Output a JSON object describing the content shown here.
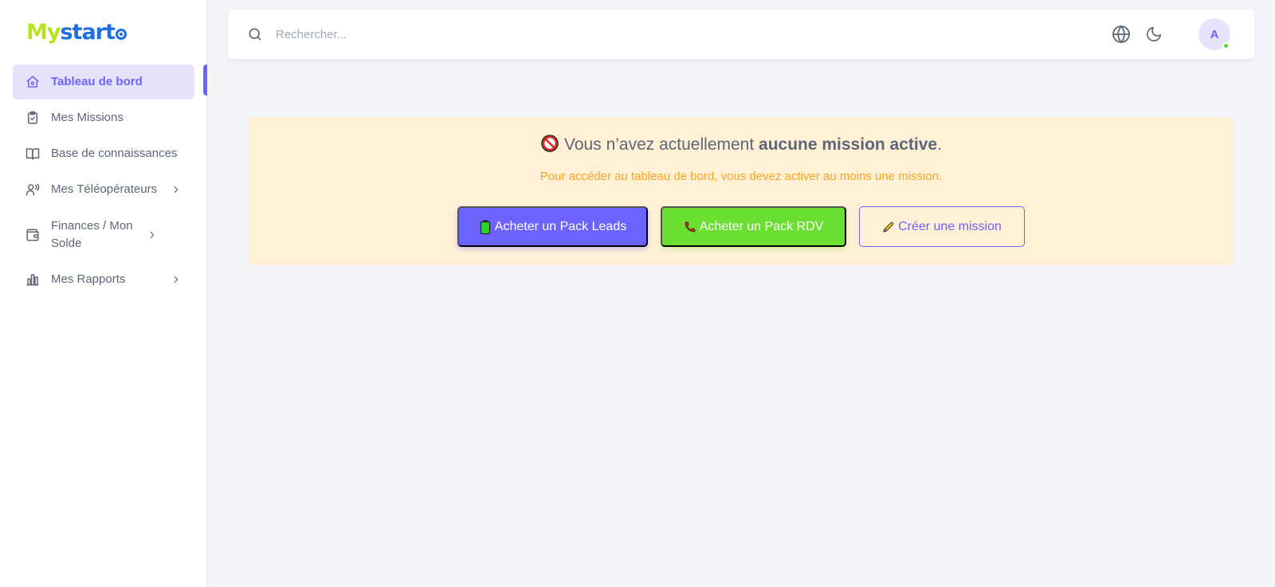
{
  "brand": {
    "part1": "My",
    "part2": "start"
  },
  "sidebar": {
    "items": [
      {
        "label": "Tableau de bord"
      },
      {
        "label": "Mes Missions"
      },
      {
        "label": "Base de connaissances"
      },
      {
        "label": "Mes Téléopérateurs"
      },
      {
        "label": "Finances / Mon Solde"
      },
      {
        "label": "Mes Rapports"
      }
    ]
  },
  "header": {
    "search_placeholder": "Rechercher...",
    "avatar_initial": "A"
  },
  "alert": {
    "title_prefix": "Vous n’avez actuellement ",
    "title_bold": "aucune mission active",
    "title_suffix": ".",
    "subtitle": "Pour accéder au tableau de bord, vous devez activer au moins une mission.",
    "buttons": {
      "leads": "Acheter un Pack Leads",
      "rdv": "Acheter un Pack RDV",
      "create": "Créer une mission"
    }
  },
  "colors": {
    "accent": "#6c63ff",
    "green": "#6ade31",
    "alert_bg": "#fff0d6",
    "alert_text": "#f5a623",
    "online": "#5ad73a"
  },
  "icons": [
    "search-icon",
    "globe-icon",
    "moon-icon",
    "home-icon",
    "clipboard-check-icon",
    "book-icon",
    "users-icon",
    "wallet-icon",
    "bar-chart-icon",
    "chevron-right-icon",
    "prohibited-icon",
    "battery-icon",
    "phone-icon",
    "pencil-icon"
  ]
}
